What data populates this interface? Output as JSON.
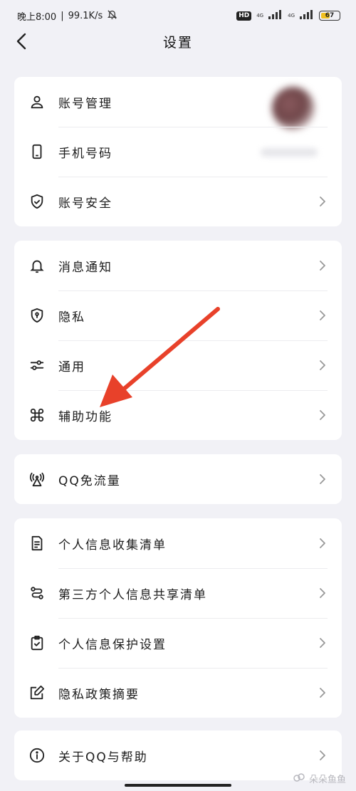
{
  "status_bar": {
    "time": "晚上8:00",
    "speed": "99.1K/s",
    "hd_label": "HD",
    "net_tag_1": "4G",
    "net_tag_2": "4G",
    "battery": "67"
  },
  "header": {
    "title": "设置"
  },
  "groups": {
    "account": [
      {
        "label": "账号管理",
        "icon": "person-icon"
      },
      {
        "label": "手机号码",
        "icon": "phone-icon"
      },
      {
        "label": "账号安全",
        "icon": "shield-check-icon"
      }
    ],
    "general": [
      {
        "label": "消息通知",
        "icon": "bell-icon"
      },
      {
        "label": "隐私",
        "icon": "privacy-shield-icon"
      },
      {
        "label": "通用",
        "icon": "sliders-icon"
      },
      {
        "label": "辅助功能",
        "icon": "command-icon"
      }
    ],
    "data": [
      {
        "label": "QQ免流量",
        "icon": "signal-tower-icon"
      }
    ],
    "privacy_docs": [
      {
        "label": "个人信息收集清单",
        "icon": "document-list-icon"
      },
      {
        "label": "第三方个人信息共享清单",
        "icon": "share-flow-icon"
      },
      {
        "label": "个人信息保护设置",
        "icon": "checked-clipboard-icon"
      },
      {
        "label": "隐私政策摘要",
        "icon": "edit-icon"
      }
    ],
    "about": [
      {
        "label": "关于QQ与帮助",
        "icon": "info-icon"
      }
    ]
  },
  "watermark": "朵朵鱼鱼",
  "colors": {
    "background": "#f1f1f6",
    "card": "#ffffff",
    "annotation_arrow": "#e8412a"
  }
}
